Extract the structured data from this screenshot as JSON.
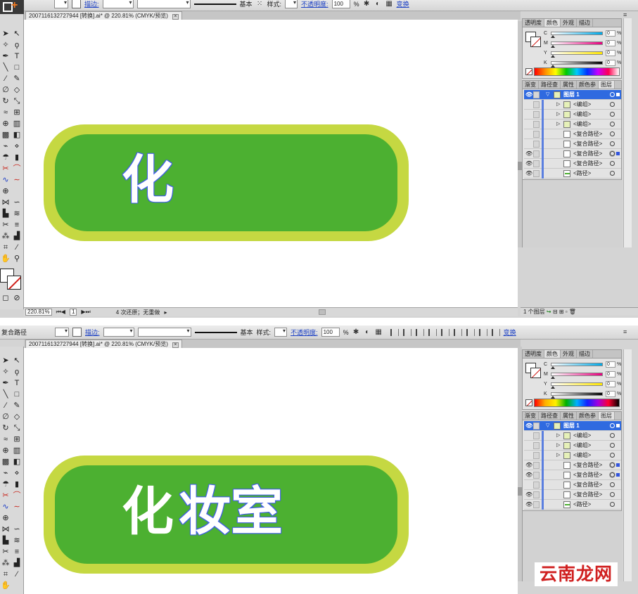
{
  "top": {
    "control_bar": {
      "stroke_label": "描边:",
      "stroke_style": "基本",
      "style_label": "样式:",
      "opacity_label": "不透明度:",
      "opacity_value": "100",
      "opacity_unit": "%",
      "transform_label": "变换"
    },
    "doc_tab": "2007116132727944  [转换].ai* @ 220.81% (CMYK/预览)",
    "canvas_text": "化",
    "status": {
      "zoom": "220.81%",
      "page": "1",
      "undo": "4 次还原；无重做"
    },
    "color_panel": {
      "tabs": [
        "透明度",
        "颜色",
        "外观",
        "描边"
      ],
      "rows": [
        {
          "letter": "C",
          "value": "0",
          "unit": "%"
        },
        {
          "letter": "M",
          "value": "0",
          "unit": "%"
        },
        {
          "letter": "Y",
          "value": "0",
          "unit": "%"
        },
        {
          "letter": "K",
          "value": "0",
          "unit": "%"
        }
      ]
    },
    "layers_panel": {
      "tabs": [
        "渐变",
        "路径查",
        "属性",
        "颜色参",
        "图层"
      ],
      "layer_name": "图层 1",
      "items": [
        "<编组>",
        "<编组>",
        "<编组>",
        "<复合路径>",
        "<复合路径>",
        "<复合路径>",
        "<复合路径>",
        "<路径>"
      ]
    },
    "layers_footer": "1 个图层"
  },
  "bottom": {
    "control_bar": {
      "selection_label": "复合路径",
      "stroke_label": "描边:",
      "stroke_style": "基本",
      "style_label": "样式:",
      "opacity_label": "不透明度:",
      "opacity_value": "100",
      "opacity_unit": "%",
      "transform_label": "变换"
    },
    "doc_tab": "2007116132727944  [转换].ai* @ 220.81% (CMYK/预览)",
    "canvas_text_1": "化",
    "canvas_text_2": "妆室",
    "color_panel": {
      "tabs": [
        "透明度",
        "颜色",
        "外观",
        "描边"
      ],
      "rows": [
        {
          "letter": "C",
          "value": "0",
          "unit": "%"
        },
        {
          "letter": "M",
          "value": "0",
          "unit": "%"
        },
        {
          "letter": "Y",
          "value": "0",
          "unit": "%"
        },
        {
          "letter": "K",
          "value": "0",
          "unit": "%"
        }
      ]
    },
    "layers_panel": {
      "tabs": [
        "渐变",
        "路径查",
        "属性",
        "颜色参",
        "图层"
      ],
      "layer_name": "图层 1",
      "items": [
        "<编组>",
        "<编组>",
        "<编组>",
        "<复合路径>",
        "<复合路径>",
        "<复合路径>",
        "<复合路径>",
        "<路径>"
      ]
    }
  },
  "watermark": "云南龙网",
  "colors": {
    "pill_outer": "#c5d842",
    "pill_inner": "#4cb031",
    "selection": "#2f6ae0",
    "link": "#1a3fc4"
  }
}
